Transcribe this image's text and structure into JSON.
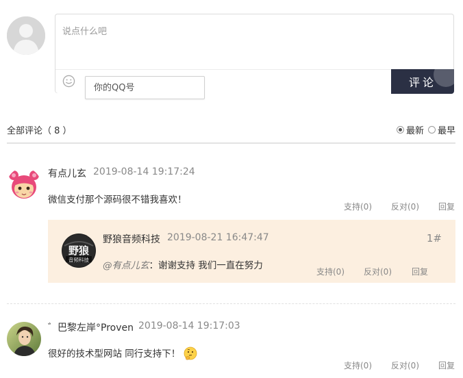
{
  "composer": {
    "textarea_placeholder": "说点什么吧",
    "qq_placeholder": "你的QQ号",
    "submit_label": "评论",
    "submit_color": "#2b3044",
    "emoji_icon": "smiley-face-icon"
  },
  "list_header": {
    "count_label": "全部评论（ 8 ）",
    "sort_options": [
      {
        "label": "最新",
        "checked": true
      },
      {
        "label": "最早",
        "checked": false
      }
    ]
  },
  "comments": [
    {
      "author": "有点儿玄",
      "time": "2019-08-14 19:17:24",
      "text": "微信支付那个源码很不错我喜欢！",
      "support_label": "支持(0)",
      "oppose_label": "反对(0)",
      "reply_label": "回复",
      "avatar_icon": "cartoon-girl-avatar",
      "replies": [
        {
          "author": "野狼音频科技",
          "time": "2019-08-21 16:47:47",
          "mention": "@有点儿玄",
          "text": "：谢谢支持 我们一直在努力",
          "floor": "1#",
          "support_label": "支持(0)",
          "oppose_label": "反对(0)",
          "reply_label": "回复",
          "avatar_text": "野狼",
          "avatar_subtext": "音频科技",
          "background_color": "#fcefe0"
        }
      ]
    },
    {
      "author": "゛巴黎左岸°Proven",
      "time": "2019-08-14 19:17:03",
      "text": "很好的技术型网站 同行支持下！",
      "support_label": "支持(0)",
      "oppose_label": "反对(0)",
      "reply_label": "回复",
      "avatar_icon": "person-photo-avatar",
      "text_emoji": "thinking-face-emoji"
    }
  ]
}
